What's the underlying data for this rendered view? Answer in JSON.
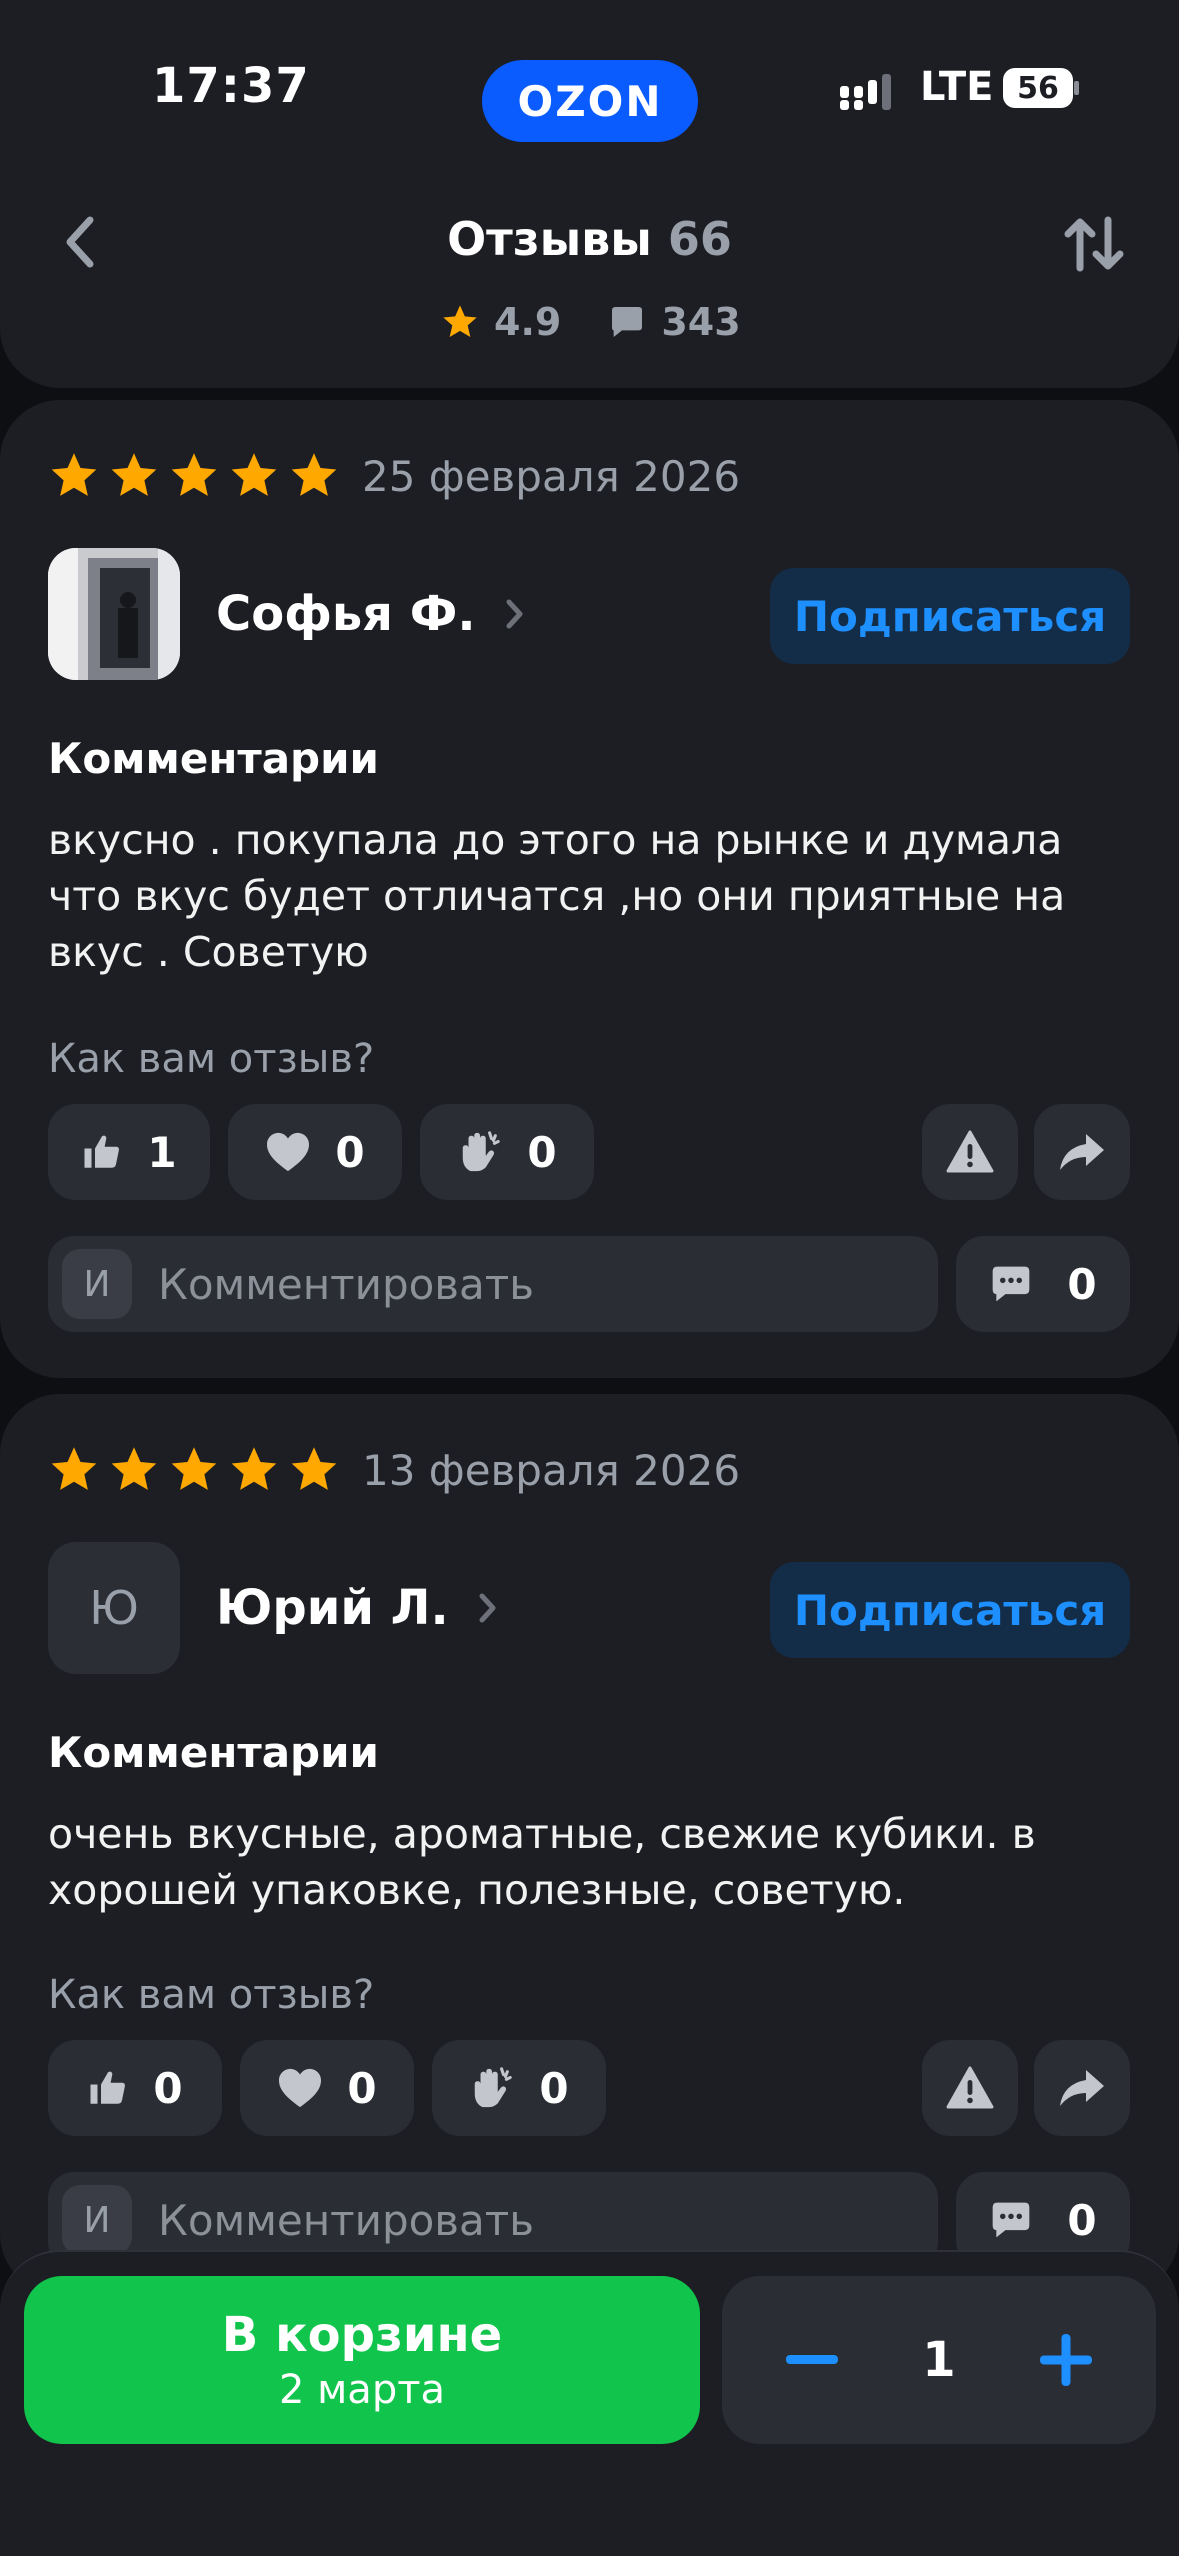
{
  "status_bar": {
    "time": "17:37",
    "network": "LTE",
    "battery": "56"
  },
  "header": {
    "logo": "OZON",
    "title": "Отзывы",
    "title_count": "66",
    "rating": "4.9",
    "reviews_count": "343"
  },
  "reviews": [
    {
      "stars": 5,
      "date": "25 февраля 2026",
      "author": "Софья Ф.",
      "avatar_initial": "",
      "subscribe_label": "Подписаться",
      "section_label": "Комментарии",
      "text": "вкусно . покупала до этого на рынке и думала что вкус будет отличатся ,но они приятные на вкус . Советую",
      "question": "Как вам отзыв?",
      "likes": "1",
      "hearts": "0",
      "claps": "0",
      "input_initial": "И",
      "input_placeholder": "Комментировать",
      "comments": "0"
    },
    {
      "stars": 5,
      "date": "13 февраля 2026",
      "author": "Юрий Л.",
      "avatar_initial": "Ю",
      "subscribe_label": "Подписаться",
      "section_label": "Комментарии",
      "text": "очень вкусные, ароматные,  свежие кубики. в хорошей упаковке, полезные, советую.",
      "question": "Как вам отзыв?",
      "likes": "0",
      "hearts": "0",
      "claps": "0",
      "input_initial": "И",
      "input_placeholder": "Комментировать",
      "comments": "0"
    }
  ],
  "bottom_bar": {
    "cart_title": "В корзине",
    "cart_subtitle": "2 марта",
    "quantity": "1"
  },
  "colors": {
    "accent_blue": "#1e8fff",
    "star": "#ffa800",
    "cart_green": "#10c44c",
    "logo_blue": "#0a5cff"
  }
}
